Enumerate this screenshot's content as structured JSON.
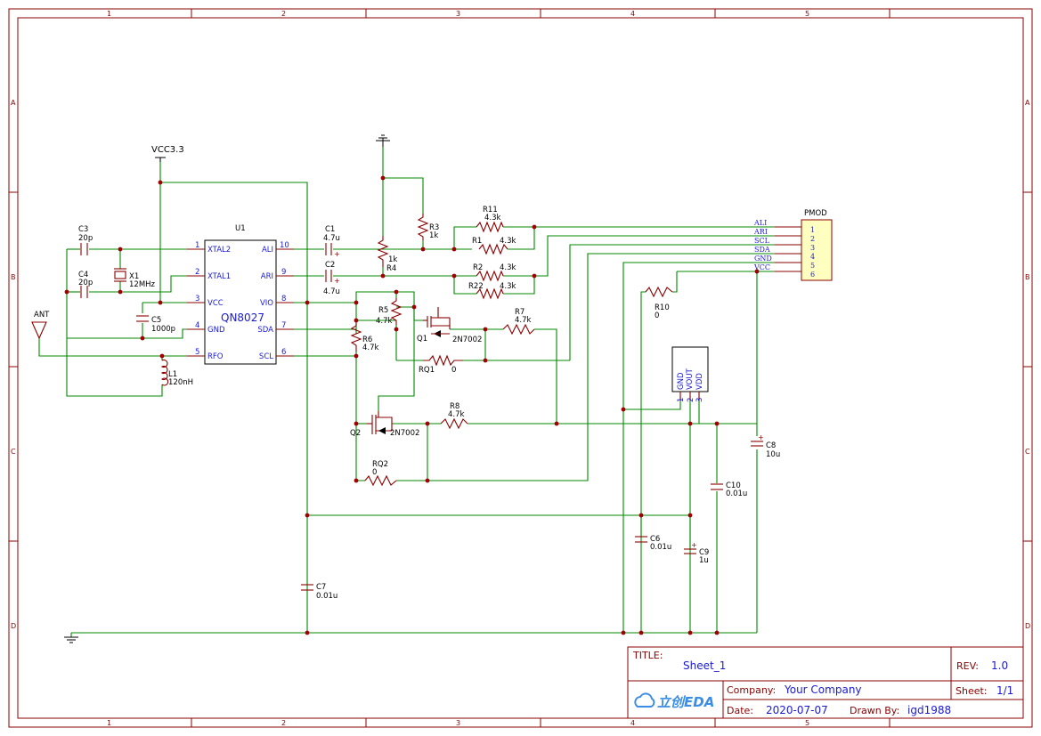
{
  "grid": {
    "columns": [
      "1",
      "2",
      "3",
      "4",
      "5"
    ],
    "rows": [
      "A",
      "B",
      "C",
      "D"
    ]
  },
  "power": {
    "vcc_label": "VCC3.3"
  },
  "u1": {
    "ref": "U1",
    "name": "QN8027",
    "left_pins": [
      {
        "num": "1",
        "name": "XTAL2"
      },
      {
        "num": "2",
        "name": "XTAL1"
      },
      {
        "num": "3",
        "name": "VCC"
      },
      {
        "num": "4",
        "name": "GND"
      },
      {
        "num": "5",
        "name": "RFO"
      }
    ],
    "right_pins": [
      {
        "num": "10",
        "name": "ALI"
      },
      {
        "num": "9",
        "name": "ARI"
      },
      {
        "num": "8",
        "name": "VIO"
      },
      {
        "num": "7",
        "name": "SDA"
      },
      {
        "num": "6",
        "name": "SCL"
      }
    ]
  },
  "parts": {
    "c3": {
      "ref": "C3",
      "val": "20p"
    },
    "c4": {
      "ref": "C4",
      "val": "20p"
    },
    "x1": {
      "ref": "X1",
      "val": "12MHz"
    },
    "c5": {
      "ref": "C5",
      "val": "1000p"
    },
    "ant": {
      "ref": "ANT"
    },
    "l1": {
      "ref": "L1",
      "val": "120nH"
    },
    "c1": {
      "ref": "C1",
      "val": "4.7u"
    },
    "c2": {
      "ref": "C2",
      "val": "4.7u"
    },
    "r3": {
      "ref": "R3",
      "val": "1k"
    },
    "r4": {
      "ref": "R4",
      "val": "1k"
    },
    "r11": {
      "ref": "R11",
      "val": "4.3k"
    },
    "r1": {
      "ref": "R1",
      "val": "4.3k"
    },
    "r2": {
      "ref": "R2",
      "val": "4.3k"
    },
    "r22": {
      "ref": "R22",
      "val": "4.3k"
    },
    "r5": {
      "ref": "R5",
      "val": "4.7k"
    },
    "r6": {
      "ref": "R6",
      "val": "4.7k"
    },
    "q1": {
      "ref": "Q1",
      "val": "2N7002"
    },
    "r7": {
      "ref": "R7",
      "val": "4.7k"
    },
    "rq1": {
      "ref": "RQ1",
      "val": "0"
    },
    "q2": {
      "ref": "Q2",
      "val": "2N7002"
    },
    "r8": {
      "ref": "R8",
      "val": "4.7k"
    },
    "rq2": {
      "ref": "RQ2",
      "val": "0"
    },
    "r10": {
      "ref": "R10",
      "val": "0"
    },
    "c8": {
      "ref": "C8",
      "val": "10u"
    },
    "c10": {
      "ref": "C10",
      "val": "0.01u"
    },
    "c6": {
      "ref": "C6",
      "val": "0.01u"
    },
    "c9": {
      "ref": "C9",
      "val": "1u"
    },
    "c7": {
      "ref": "C7",
      "val": "0.01u"
    }
  },
  "pmod": {
    "ref": "PMOD",
    "pins": [
      {
        "num": "1",
        "net": "ALI"
      },
      {
        "num": "2",
        "net": "ARI"
      },
      {
        "num": "3",
        "net": "SCL"
      },
      {
        "num": "4",
        "net": "SDA"
      },
      {
        "num": "5",
        "net": "GND"
      },
      {
        "num": "6",
        "net": "VCC"
      }
    ]
  },
  "regulator": {
    "pins": [
      {
        "num": "1",
        "name": "GND"
      },
      {
        "num": "2",
        "name": "VOUT"
      },
      {
        "num": "3",
        "name": "VDD"
      }
    ]
  },
  "title_block": {
    "title_label": "TITLE:",
    "title_value": "Sheet_1",
    "rev_label": "REV:",
    "rev_value": "1.0",
    "company_label": "Company:",
    "company_value": "Your Company",
    "sheet_label": "Sheet:",
    "sheet_value": "1/1",
    "date_label": "Date:",
    "date_value": "2020-07-07",
    "drawn_label": "Drawn By:",
    "drawn_value": "igd1988",
    "logo_text": "立创EDA"
  },
  "colors": {
    "frame": "#8b0000",
    "wire": "#008800",
    "component": "#8b0000",
    "pin_text": "#1a1ad6",
    "junction": "#a00000",
    "pmod_fill": "#ffffc0"
  }
}
